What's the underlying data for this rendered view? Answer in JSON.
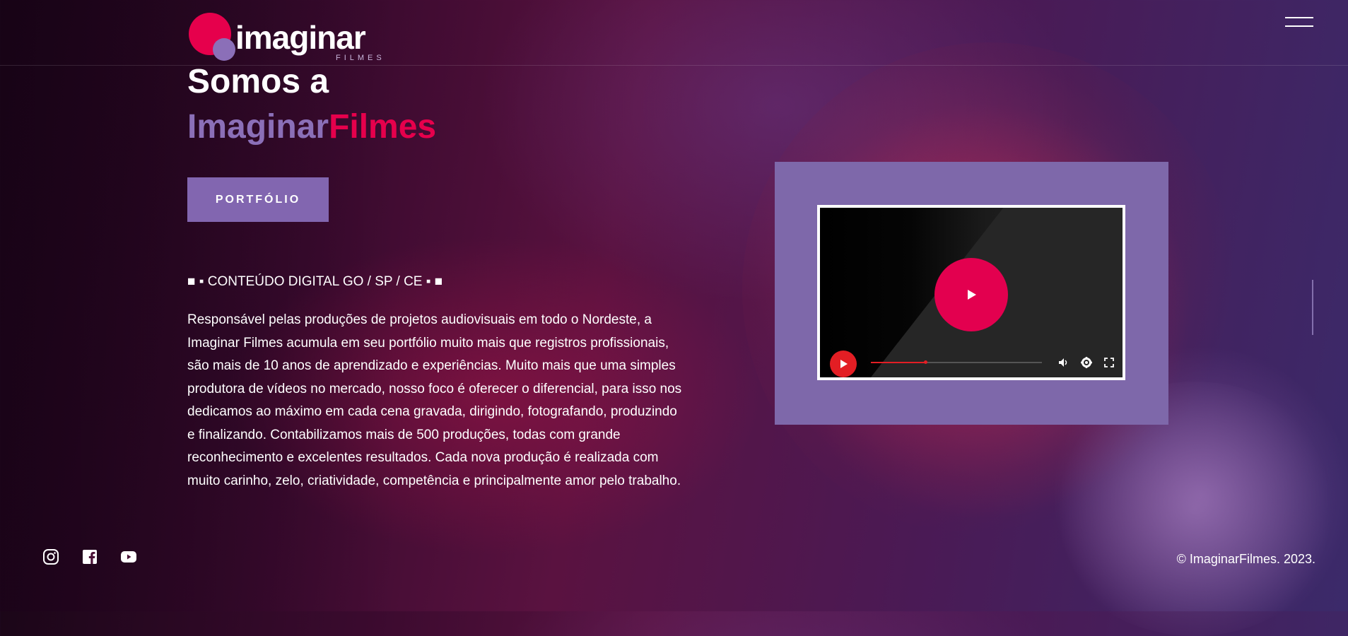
{
  "brand": {
    "logo_word": "imaginar",
    "logo_sub": "FILMES",
    "colors": {
      "primary_purple": "#8266b0",
      "accent_pink": "#e6004c",
      "video_bg": "#7e68aa"
    }
  },
  "header": {
    "menu_icon": "hamburger-icon"
  },
  "hero": {
    "title_line1": "Somos a",
    "title_line2_a": "Imaginar",
    "title_line2_b": "Filmes",
    "portfolio_button": "PORTFÓLIO",
    "tagline": "■ ▪ CONTEÚDO DIGITAL GO / SP / CE ▪ ■",
    "description": "Responsável pelas produções de projetos audiovisuais em todo o Nordeste, a Imaginar Filmes acumula em seu portfólio muito mais que registros profissionais, são mais de 10 anos de aprendizado e experiências. Muito mais que uma simples produtora de vídeos no mercado, nosso foco é oferecer o diferencial, para isso nos dedicamos ao máximo em cada cena gravada, dirigindo, fotografando, produzindo e finalizando. Contabilizamos mais de 500 produções, todas com grande reconhecimento e excelentes resultados. Cada nova produção é realizada com muito carinho, zelo, criatividade, competência e principalmente amor pelo trabalho."
  },
  "video": {
    "play_icon": "play-icon",
    "progress_fraction": 0.32,
    "controls": [
      "play-icon",
      "volume-icon",
      "settings-icon",
      "fullscreen-icon"
    ]
  },
  "footer": {
    "socials": [
      "instagram-icon",
      "facebook-icon",
      "youtube-icon"
    ],
    "copyright": "© ImaginarFilmes. 2023."
  }
}
